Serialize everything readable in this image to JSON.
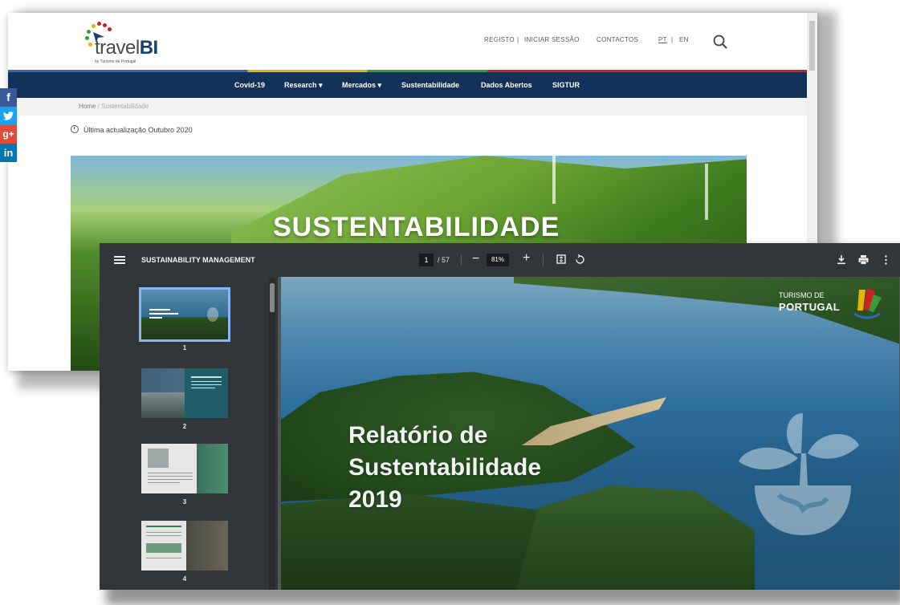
{
  "website": {
    "logo": {
      "name_plain": "travel",
      "name_bold": "BI",
      "tagline": "by Turismo de Portugal"
    },
    "header_links": {
      "registo": "REGISTO",
      "sep": "|",
      "login": "INICIAR SESSÃO",
      "contactos": "CONTACTOS",
      "lang_pt": "PT",
      "lang_en": "EN"
    },
    "nav": [
      "Covid-19",
      "Research ▾",
      "Mercados ▾",
      "Sustentabilidade",
      "Dados Abertos",
      "SIGTUR"
    ],
    "breadcrumb": {
      "home": "Home",
      "sep": "/",
      "current": "Sustentabilidade"
    },
    "updated": "Última actualização Outubro 2020",
    "hero_title": "SUSTENTABILIDADE",
    "share_icons": [
      {
        "icon": "facebook-icon",
        "glyph": "f",
        "color": "#3b5998"
      },
      {
        "icon": "twitter-icon",
        "glyph": "🐦",
        "color": "#1da1f2"
      },
      {
        "icon": "googleplus-icon",
        "glyph": "g+",
        "color": "#dd4b39"
      },
      {
        "icon": "linkedin-icon",
        "glyph": "in",
        "color": "#0077b5"
      }
    ],
    "colors": {
      "navbar": "#12325a",
      "accent_red": "#d12020"
    }
  },
  "viewer": {
    "title": "SUSTAINABILITY MANAGEMENT",
    "page_current": "1",
    "page_total": "/ 57",
    "zoom": "81%",
    "thumbnails": [
      {
        "num": "1"
      },
      {
        "num": "2"
      },
      {
        "num": "3"
      },
      {
        "num": "4"
      }
    ],
    "page": {
      "title_lines": [
        "Relatório de",
        "Sustentabilidade",
        "2019"
      ],
      "brand_top": "TURISMO DE",
      "brand_main": "PORTUGAL"
    },
    "icons": [
      "menu-icon",
      "zoom-minus-icon",
      "zoom-plus-icon",
      "fit-page-icon",
      "rotate-icon",
      "download-icon",
      "print-icon",
      "more-vert-icon"
    ]
  }
}
